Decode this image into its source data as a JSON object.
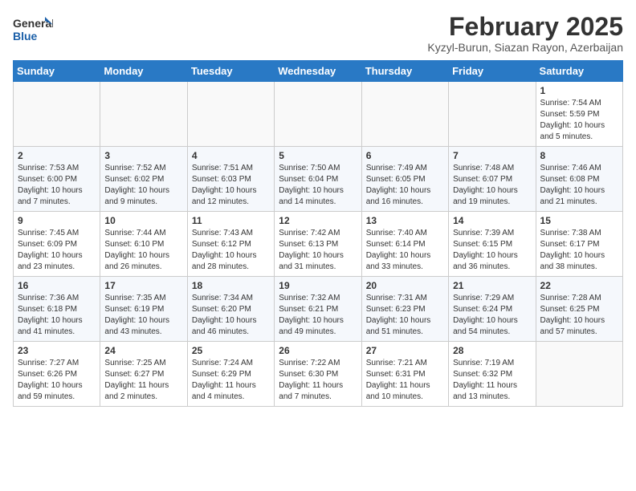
{
  "header": {
    "logo_general": "General",
    "logo_blue": "Blue",
    "month_title": "February 2025",
    "location": "Kyzyl-Burun, Siazan Rayon, Azerbaijan"
  },
  "weekdays": [
    "Sunday",
    "Monday",
    "Tuesday",
    "Wednesday",
    "Thursday",
    "Friday",
    "Saturday"
  ],
  "weeks": [
    [
      {
        "day": "",
        "info": ""
      },
      {
        "day": "",
        "info": ""
      },
      {
        "day": "",
        "info": ""
      },
      {
        "day": "",
        "info": ""
      },
      {
        "day": "",
        "info": ""
      },
      {
        "day": "",
        "info": ""
      },
      {
        "day": "1",
        "info": "Sunrise: 7:54 AM\nSunset: 5:59 PM\nDaylight: 10 hours and 5 minutes."
      }
    ],
    [
      {
        "day": "2",
        "info": "Sunrise: 7:53 AM\nSunset: 6:00 PM\nDaylight: 10 hours and 7 minutes."
      },
      {
        "day": "3",
        "info": "Sunrise: 7:52 AM\nSunset: 6:02 PM\nDaylight: 10 hours and 9 minutes."
      },
      {
        "day": "4",
        "info": "Sunrise: 7:51 AM\nSunset: 6:03 PM\nDaylight: 10 hours and 12 minutes."
      },
      {
        "day": "5",
        "info": "Sunrise: 7:50 AM\nSunset: 6:04 PM\nDaylight: 10 hours and 14 minutes."
      },
      {
        "day": "6",
        "info": "Sunrise: 7:49 AM\nSunset: 6:05 PM\nDaylight: 10 hours and 16 minutes."
      },
      {
        "day": "7",
        "info": "Sunrise: 7:48 AM\nSunset: 6:07 PM\nDaylight: 10 hours and 19 minutes."
      },
      {
        "day": "8",
        "info": "Sunrise: 7:46 AM\nSunset: 6:08 PM\nDaylight: 10 hours and 21 minutes."
      }
    ],
    [
      {
        "day": "9",
        "info": "Sunrise: 7:45 AM\nSunset: 6:09 PM\nDaylight: 10 hours and 23 minutes."
      },
      {
        "day": "10",
        "info": "Sunrise: 7:44 AM\nSunset: 6:10 PM\nDaylight: 10 hours and 26 minutes."
      },
      {
        "day": "11",
        "info": "Sunrise: 7:43 AM\nSunset: 6:12 PM\nDaylight: 10 hours and 28 minutes."
      },
      {
        "day": "12",
        "info": "Sunrise: 7:42 AM\nSunset: 6:13 PM\nDaylight: 10 hours and 31 minutes."
      },
      {
        "day": "13",
        "info": "Sunrise: 7:40 AM\nSunset: 6:14 PM\nDaylight: 10 hours and 33 minutes."
      },
      {
        "day": "14",
        "info": "Sunrise: 7:39 AM\nSunset: 6:15 PM\nDaylight: 10 hours and 36 minutes."
      },
      {
        "day": "15",
        "info": "Sunrise: 7:38 AM\nSunset: 6:17 PM\nDaylight: 10 hours and 38 minutes."
      }
    ],
    [
      {
        "day": "16",
        "info": "Sunrise: 7:36 AM\nSunset: 6:18 PM\nDaylight: 10 hours and 41 minutes."
      },
      {
        "day": "17",
        "info": "Sunrise: 7:35 AM\nSunset: 6:19 PM\nDaylight: 10 hours and 43 minutes."
      },
      {
        "day": "18",
        "info": "Sunrise: 7:34 AM\nSunset: 6:20 PM\nDaylight: 10 hours and 46 minutes."
      },
      {
        "day": "19",
        "info": "Sunrise: 7:32 AM\nSunset: 6:21 PM\nDaylight: 10 hours and 49 minutes."
      },
      {
        "day": "20",
        "info": "Sunrise: 7:31 AM\nSunset: 6:23 PM\nDaylight: 10 hours and 51 minutes."
      },
      {
        "day": "21",
        "info": "Sunrise: 7:29 AM\nSunset: 6:24 PM\nDaylight: 10 hours and 54 minutes."
      },
      {
        "day": "22",
        "info": "Sunrise: 7:28 AM\nSunset: 6:25 PM\nDaylight: 10 hours and 57 minutes."
      }
    ],
    [
      {
        "day": "23",
        "info": "Sunrise: 7:27 AM\nSunset: 6:26 PM\nDaylight: 10 hours and 59 minutes."
      },
      {
        "day": "24",
        "info": "Sunrise: 7:25 AM\nSunset: 6:27 PM\nDaylight: 11 hours and 2 minutes."
      },
      {
        "day": "25",
        "info": "Sunrise: 7:24 AM\nSunset: 6:29 PM\nDaylight: 11 hours and 4 minutes."
      },
      {
        "day": "26",
        "info": "Sunrise: 7:22 AM\nSunset: 6:30 PM\nDaylight: 11 hours and 7 minutes."
      },
      {
        "day": "27",
        "info": "Sunrise: 7:21 AM\nSunset: 6:31 PM\nDaylight: 11 hours and 10 minutes."
      },
      {
        "day": "28",
        "info": "Sunrise: 7:19 AM\nSunset: 6:32 PM\nDaylight: 11 hours and 13 minutes."
      },
      {
        "day": "",
        "info": ""
      }
    ]
  ]
}
